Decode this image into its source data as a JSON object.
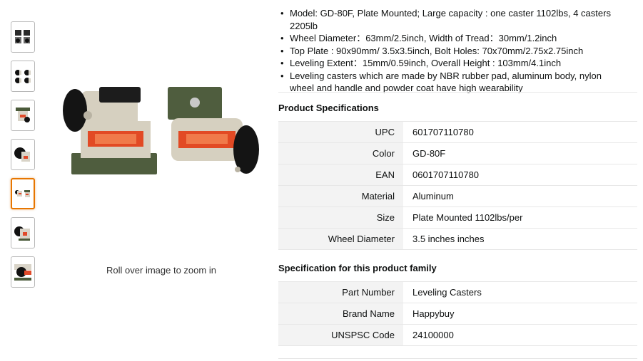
{
  "gallery": {
    "thumbnails": [
      {
        "name": "front-pair"
      },
      {
        "name": "four-casters"
      },
      {
        "name": "side-view"
      },
      {
        "name": "wheel-closeup"
      },
      {
        "name": "pair-angle",
        "selected": true
      },
      {
        "name": "single-caster"
      },
      {
        "name": "detail-closeup"
      }
    ],
    "zoom_hint": "Roll over image to zoom in"
  },
  "bullets": [
    "Model: GD-80F, Plate Mounted; Large capacity : one caster 1102lbs, 4 casters 2205lb",
    "Wheel Diameter：63mm/2.5inch, Width of Tread：30mm/1.2inch",
    "Top Plate : 90x90mm/ 3.5x3.5inch, Bolt Holes: 70x70mm/2.75x2.75inch",
    "Leveling Extent：15mm/0.59inch, Overall Height : 103mm/4.1inch",
    "Leveling casters which are made by NBR rubber pad, aluminum body, nylon wheel and handle and powder coat have high wearability"
  ],
  "product_specs": {
    "title": "Product Specifications",
    "rows": [
      {
        "key": "UPC",
        "value": "601707110780"
      },
      {
        "key": "Color",
        "value": "GD-80F"
      },
      {
        "key": "EAN",
        "value": "0601707110780"
      },
      {
        "key": "Material",
        "value": "Aluminum"
      },
      {
        "key": "Size",
        "value": "Plate Mounted 1102lbs/per"
      },
      {
        "key": "Wheel Diameter",
        "value": "3.5 inches  inches"
      }
    ]
  },
  "family_specs": {
    "title": "Specification for this product family",
    "rows": [
      {
        "key": "Part Number",
        "value": "Leveling Casters"
      },
      {
        "key": "Brand Name",
        "value": "Happybuy"
      },
      {
        "key": "UNSPSC Code",
        "value": "24100000"
      }
    ]
  }
}
